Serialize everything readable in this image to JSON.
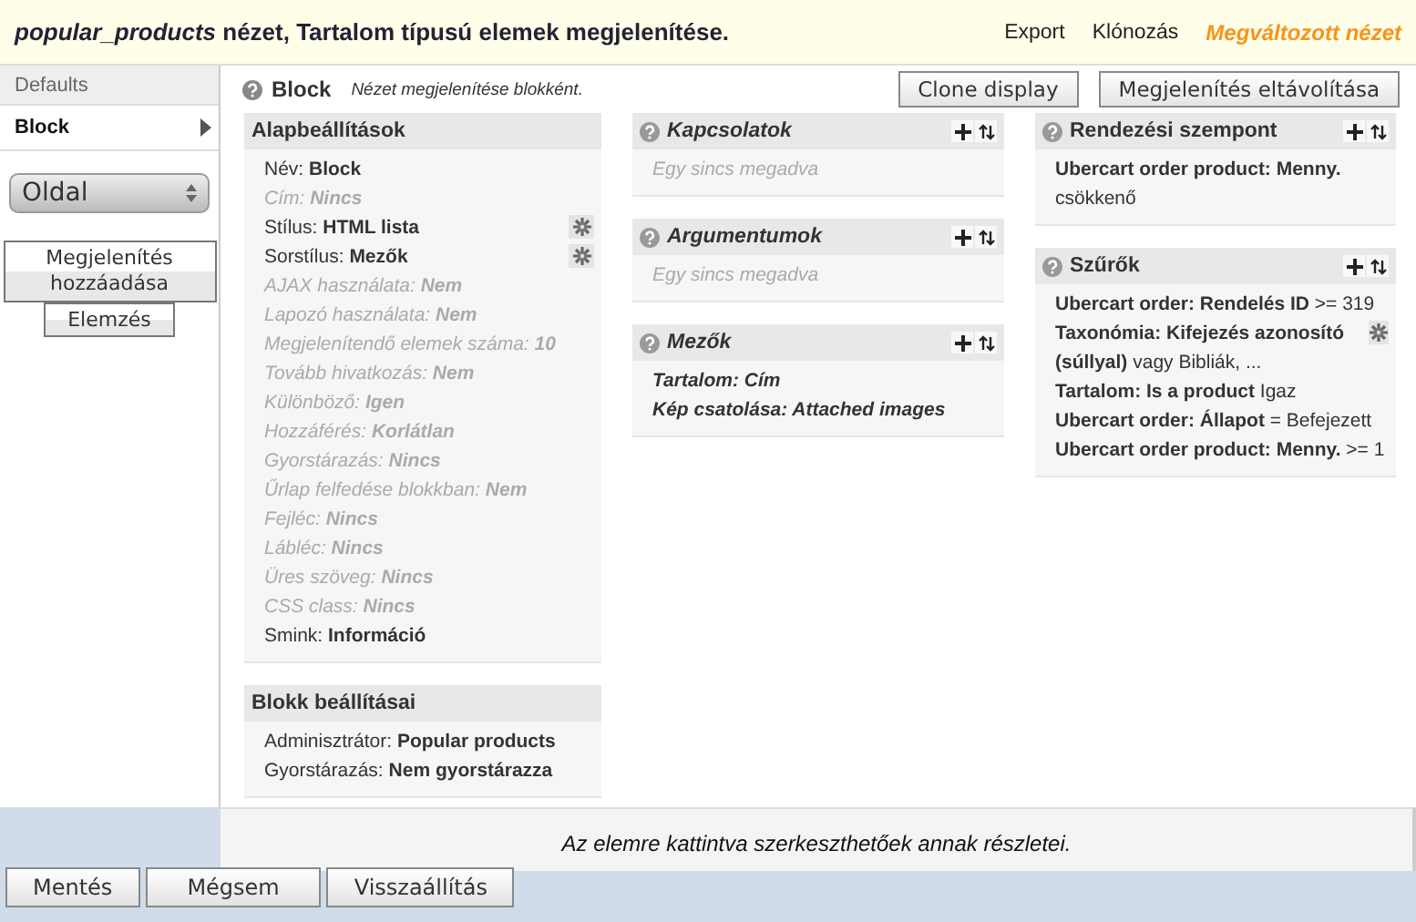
{
  "header": {
    "title": "*popular_products* nézet, Tartalom típusú elemek megjelenítése.",
    "links": [
      {
        "label": "Export",
        "kind": "link"
      },
      {
        "label": "Klónozás",
        "kind": "link"
      },
      {
        "label": "Megváltozott nézet",
        "kind": "status"
      }
    ]
  },
  "display_tabs": [
    {
      "label": "Defaults",
      "selected": false
    },
    {
      "label": "Block",
      "selected": true
    }
  ],
  "display_select": "Oldal",
  "sidebar_buttons": [
    "Megjelenítés hozzáadása",
    "Elemzés"
  ],
  "display": {
    "name": "Block",
    "description": "Nézet megjelenítése blokként.",
    "buttons": [
      "Clone display",
      "Megjelenítés eltávolítása"
    ]
  },
  "columns": [
    {
      "sections": [
        {
          "title": "Alapbeállítások",
          "help": false,
          "overridden": false,
          "actions": false,
          "items": [
            {
              "text": "Név: **Block**",
              "defaulted": false,
              "gear": false
            },
            {
              "text": "Cím: **Nincs**",
              "defaulted": true,
              "gear": false
            },
            {
              "text": "Stílus: **HTML lista**",
              "defaulted": false,
              "gear": true
            },
            {
              "text": "Sorstílus: **Mezők**",
              "defaulted": false,
              "gear": true
            },
            {
              "text": "AJAX használata: **Nem**",
              "defaulted": true,
              "gear": false
            },
            {
              "text": "Lapozó használata: **Nem**",
              "defaulted": true,
              "gear": false
            },
            {
              "text": "Megjelenítendő elemek száma: **10**",
              "defaulted": true,
              "gear": false
            },
            {
              "text": "Tovább hivatkozás: **Nem**",
              "defaulted": true,
              "gear": false
            },
            {
              "text": "Különböző: **Igen**",
              "defaulted": true,
              "gear": false
            },
            {
              "text": "Hozzáférés: **Korlátlan**",
              "defaulted": true,
              "gear": false
            },
            {
              "text": "Gyorstárazás: **Nincs**",
              "defaulted": true,
              "gear": false
            },
            {
              "text": "Űrlap felfedése blokkban: **Nem**",
              "defaulted": true,
              "gear": false
            },
            {
              "text": "Fejléc: **Nincs**",
              "defaulted": true,
              "gear": false
            },
            {
              "text": "Lábléc: **Nincs**",
              "defaulted": true,
              "gear": false
            },
            {
              "text": "Üres szöveg: **Nincs**",
              "defaulted": true,
              "gear": false
            },
            {
              "text": "CSS class: **Nincs**",
              "defaulted": true,
              "gear": false
            },
            {
              "text": "Smink: **Információ**",
              "defaulted": false,
              "gear": false
            }
          ]
        },
        {
          "title": "Blokk beállításai",
          "help": false,
          "overridden": false,
          "actions": false,
          "items": [
            {
              "text": "Adminisztrátor: **Popular products**",
              "defaulted": false,
              "gear": false
            },
            {
              "text": "Gyorstárazás: **Nem gyorstárazza**",
              "defaulted": false,
              "gear": false
            }
          ]
        }
      ]
    },
    {
      "sections": [
        {
          "title": "Kapcsolatok",
          "help": true,
          "overridden": true,
          "actions": true,
          "empty_text": "Egy sincs megadva"
        },
        {
          "title": "Argumentumok",
          "help": true,
          "overridden": true,
          "actions": true,
          "empty_text": "Egy sincs megadva"
        },
        {
          "title": "Mezők",
          "help": true,
          "overridden": true,
          "actions": true,
          "items": [
            {
              "text": "**Tartalom: Cím**",
              "defaulted": false,
              "gear": false
            },
            {
              "text": "**Kép csatolása: Attached images**",
              "defaulted": false,
              "gear": false
            }
          ]
        }
      ]
    },
    {
      "sections": [
        {
          "title": "Rendezési szempont",
          "help": true,
          "overridden": false,
          "actions": true,
          "items": [
            {
              "text": "**Ubercart order product: Menny.** csökkenő",
              "defaulted": false,
              "gear": false
            }
          ]
        },
        {
          "title": "Szűrők",
          "help": true,
          "overridden": false,
          "actions": true,
          "items": [
            {
              "text": "**Ubercart order: Rendelés ID** >= 319",
              "defaulted": false,
              "gear": false
            },
            {
              "text": "**Taxonómia: Kifejezés azonosító (súllyal)** vagy Bibliák, ...",
              "defaulted": false,
              "gear": true
            },
            {
              "text": "**Tartalom: Is a product** Igaz",
              "defaulted": false,
              "gear": false
            },
            {
              "text": "**Ubercart order: Állapot** = Befejezett",
              "defaulted": false,
              "gear": false
            },
            {
              "text": "**Ubercart order product: Menny.** >= 1",
              "defaulted": false,
              "gear": false
            }
          ]
        }
      ]
    }
  ],
  "footer_note": "Az elemre kattintva szerkeszthetőek annak részletei.",
  "bottom_buttons": [
    "Mentés",
    "Mégsem",
    "Visszaállítás"
  ]
}
